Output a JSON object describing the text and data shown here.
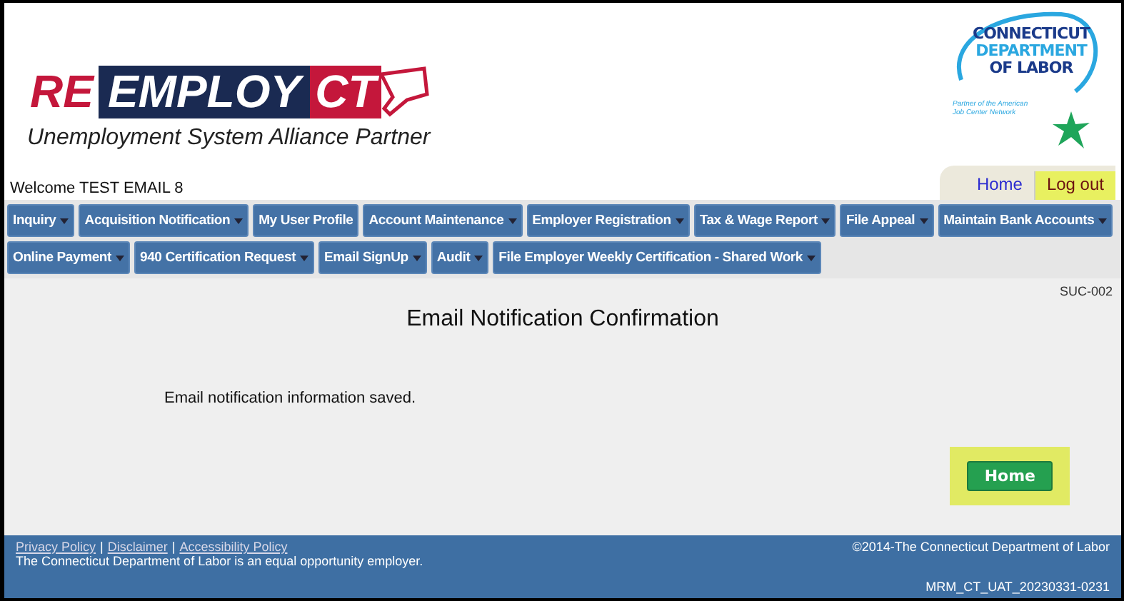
{
  "logo": {
    "re": "RE",
    "employ": "EMPLOY",
    "ct": "CT",
    "tagline": "Unemployment System Alliance Partner"
  },
  "dol_logo": {
    "lines": [
      "CONNECTICUT",
      "DEPARTMENT",
      "OF LABOR"
    ],
    "partner": [
      "Partner of the American",
      "Job Center Network"
    ]
  },
  "welcome": "Welcome TEST EMAIL 8",
  "top_links": [
    {
      "label": "Home",
      "kind": "link",
      "highlighted": false
    },
    {
      "label": "Log out",
      "kind": "logout",
      "highlighted": true
    }
  ],
  "menu_rows": [
    [
      {
        "label": "Inquiry",
        "has_menu": true
      },
      {
        "label": "Acquisition Notification",
        "has_menu": true
      },
      {
        "label": "My User Profile",
        "has_menu": false
      },
      {
        "label": "Account Maintenance",
        "has_menu": true
      },
      {
        "label": "Employer Registration",
        "has_menu": true
      },
      {
        "label": "Tax & Wage Report",
        "has_menu": true
      },
      {
        "label": "File Appeal",
        "has_menu": true
      },
      {
        "label": "Maintain Bank Accounts",
        "has_menu": true
      }
    ],
    [
      {
        "label": "Online Payment",
        "has_menu": true
      },
      {
        "label": "940 Certification Request",
        "has_menu": true
      },
      {
        "label": "Email SignUp",
        "has_menu": true
      },
      {
        "label": "Audit",
        "has_menu": true
      },
      {
        "label": "File Employer Weekly Certification - Shared Work",
        "has_menu": true
      }
    ]
  ],
  "page_code": "SUC-002",
  "heading": "Email Notification Confirmation",
  "message": "Email notification information saved.",
  "home_button": {
    "label": "Home",
    "highlighted": true
  },
  "footer": {
    "links": [
      "Privacy Policy",
      "Disclaimer",
      "Accessibility Policy"
    ],
    "separator": "|",
    "notice": "The Connecticut Department of Labor is an equal opportunity employer.",
    "copyright": "©2014-The Connecticut Department of Labor",
    "build": "MRM_CT_UAT_20230331-0231"
  }
}
